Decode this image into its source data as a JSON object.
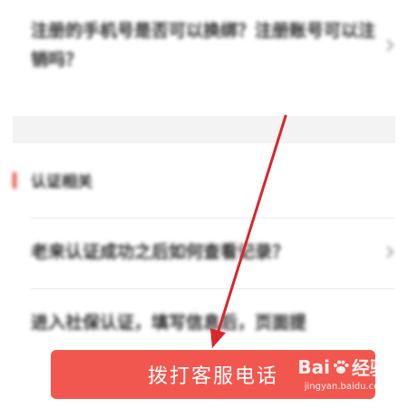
{
  "faq": {
    "items": [
      {
        "text": "注册的手机号是否可以换绑？注册账号可以注销吗？"
      },
      {
        "text": "老来认证成功之后如何查看记录？"
      },
      {
        "text": "进入社保认证，填写信息后，页面提"
      }
    ]
  },
  "section": {
    "title": "认证相关"
  },
  "cta": {
    "label": "拨打客服电话"
  },
  "watermark": {
    "brand": "Bai",
    "brand_suffix": "经验",
    "url": "jingyan.baidu.com"
  },
  "colors": {
    "accent": "#e8463f",
    "button": "#f2574f",
    "arrow": "#d9262c"
  },
  "icons": [
    "chevron-right-icon",
    "arrow-annotation-icon",
    "paw-icon"
  ]
}
